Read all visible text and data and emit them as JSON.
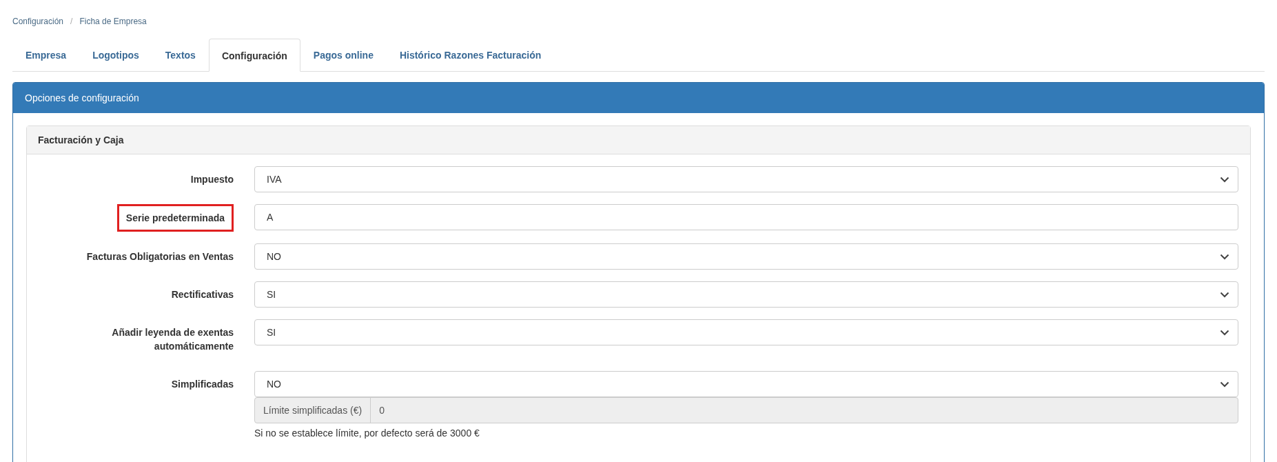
{
  "breadcrumb": [
    "Configuración",
    "Ficha de Empresa"
  ],
  "breadcrumb_separator": "/",
  "tabs": [
    {
      "label": "Empresa",
      "selected": false
    },
    {
      "label": "Logotipos",
      "selected": false
    },
    {
      "label": "Textos",
      "selected": false
    },
    {
      "label": "Configuración",
      "selected": true
    },
    {
      "label": "Pagos online",
      "selected": false
    },
    {
      "label": "Histórico Razones Facturación",
      "selected": false
    }
  ],
  "panel": {
    "title": "Opciones de configuración",
    "section": {
      "title": "Facturación y Caja",
      "fields": [
        {
          "label": "Impuesto",
          "kind": "select",
          "value": "IVA",
          "highlighted": false
        },
        {
          "label": "Serie predeterminada",
          "kind": "text",
          "value": "A",
          "highlighted": true
        },
        {
          "label": "Facturas Obligatorias en Ventas",
          "kind": "select",
          "value": "NO",
          "highlighted": false
        },
        {
          "label": "Rectificativas",
          "kind": "select",
          "value": "SI",
          "highlighted": false
        },
        {
          "label": "Añadir leyenda de exentas automáticamente",
          "kind": "select",
          "value": "SI",
          "highlighted": false
        },
        {
          "label": "Simplificadas",
          "kind": "select",
          "value": "NO",
          "highlighted": false,
          "addon": {
            "label": "Límite simplificadas (€)",
            "value": "0",
            "disabled": true
          },
          "help": "Si no se establece límite, por defecto será de 3000 €"
        }
      ]
    }
  }
}
